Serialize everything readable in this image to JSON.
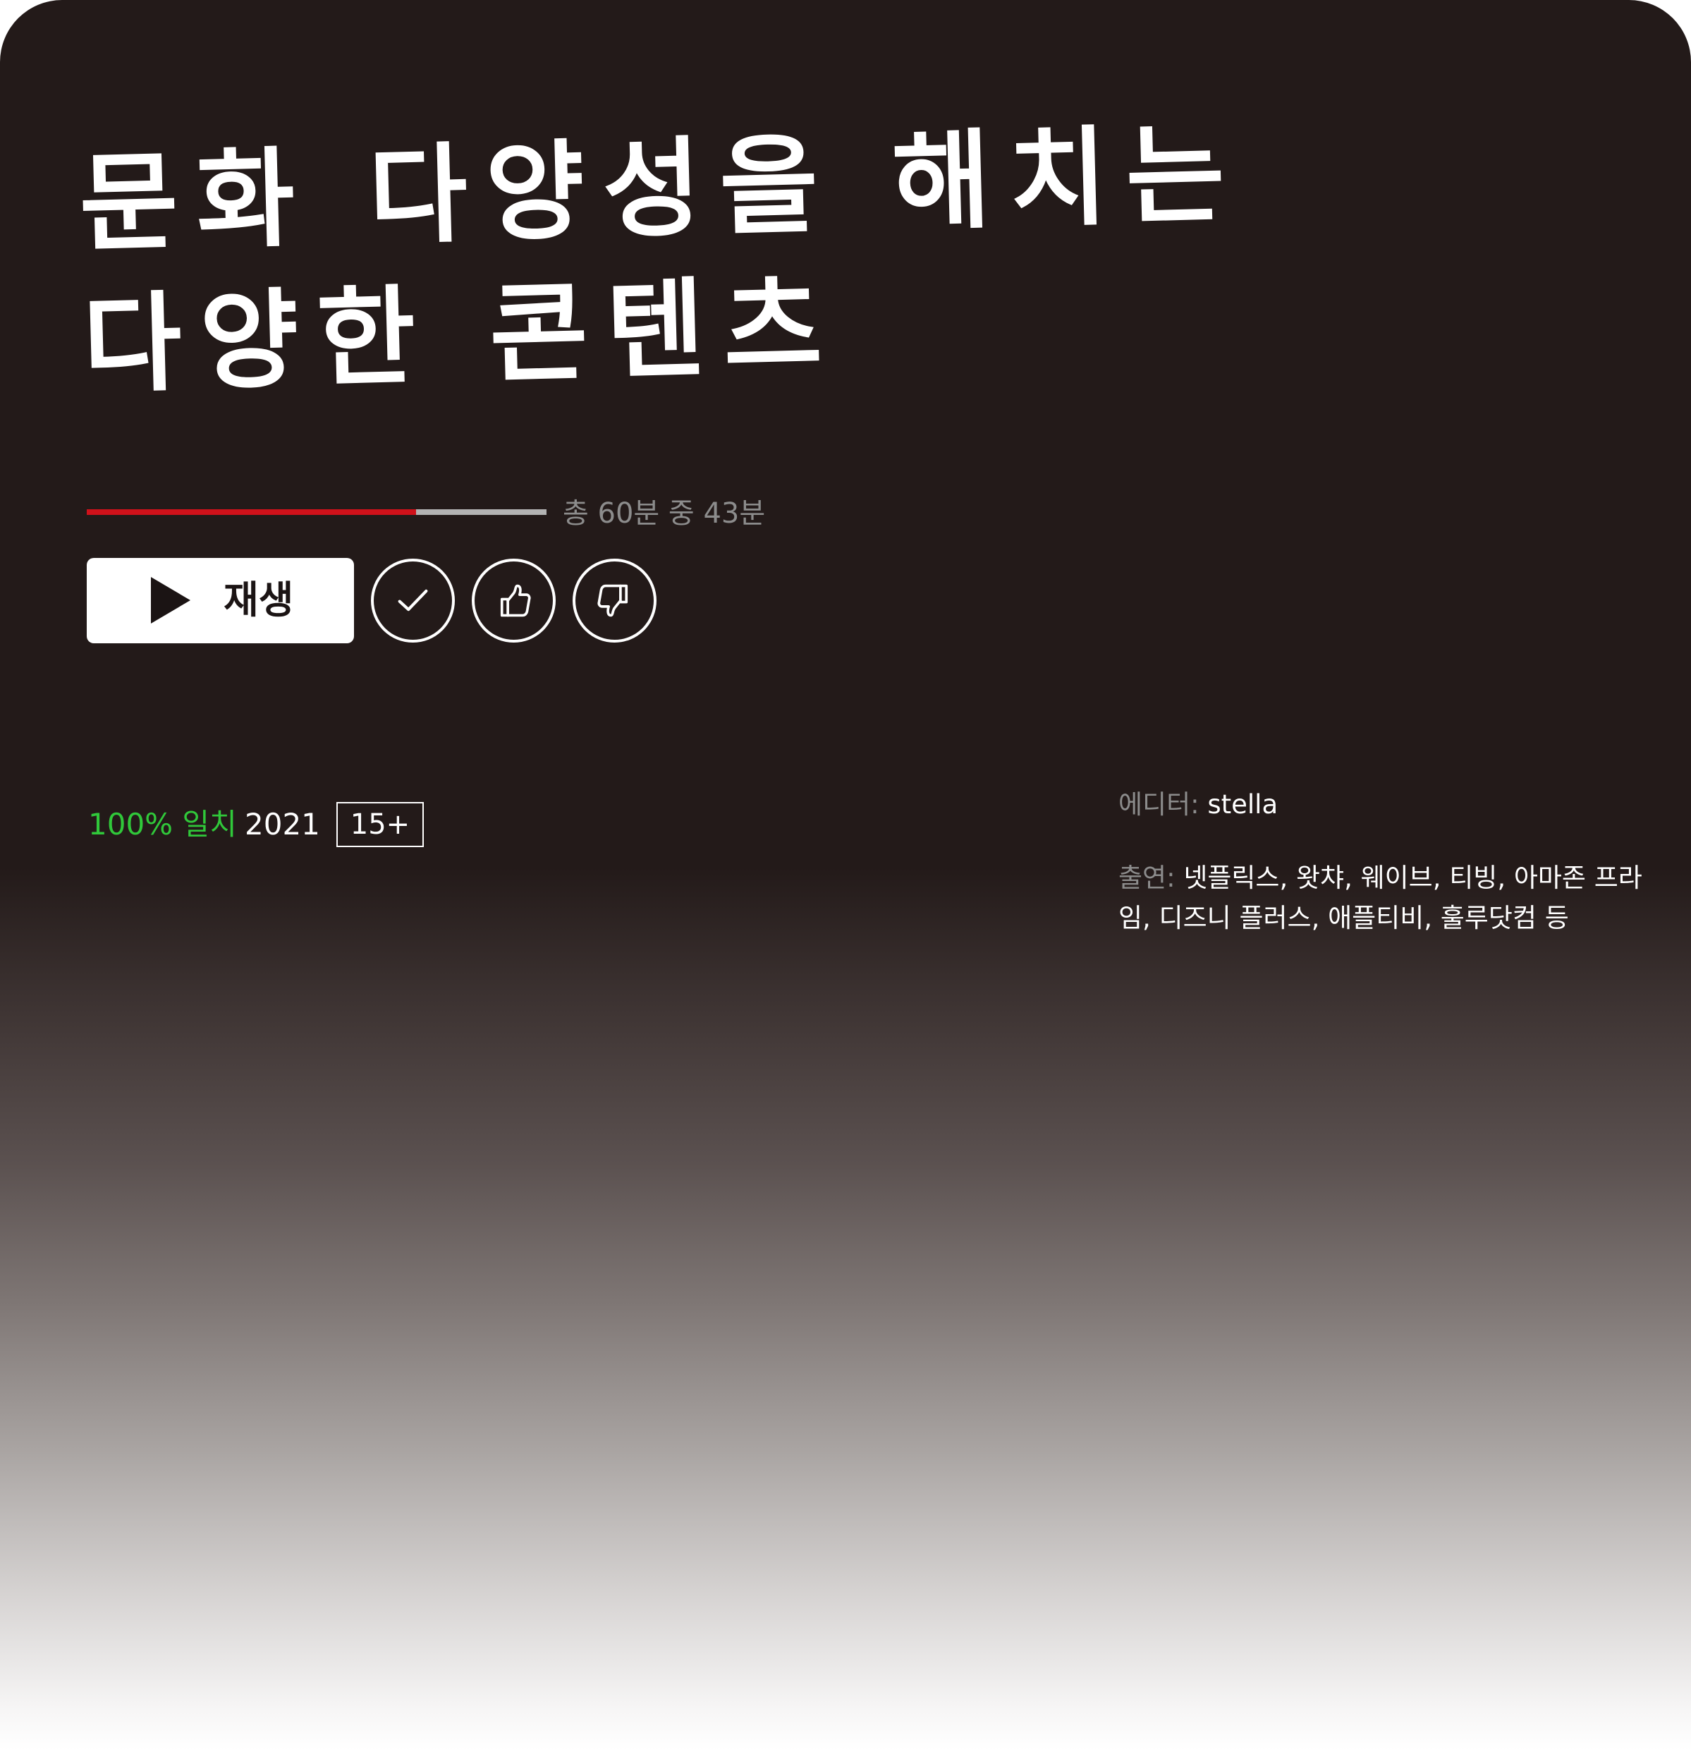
{
  "title": {
    "line1": "문화 다양성을 해치는",
    "line2": "다양한 콘텐츠"
  },
  "progress": {
    "label": "총 60분 중 43분",
    "watched_minutes": 43,
    "total_minutes": 60,
    "fill_color": "#d0111a",
    "track_color": "#b3b3b3"
  },
  "actions": {
    "play_label": "재생",
    "play_icon": "play-icon",
    "add_icon": "check-icon",
    "like_icon": "thumbs-up-icon",
    "dislike_icon": "thumbs-down-icon"
  },
  "meta": {
    "match": "100% 일치",
    "match_color": "#30c83a",
    "year": "2021",
    "rating": "15+"
  },
  "credits": {
    "editor_label": "에디터:",
    "editor": "stella",
    "cast_label": "출연:",
    "cast": "넷플릭스, 왓챠, 웨이브, 티빙, 아마존 프라임, 디즈니 플러스, 애플티비, 훌루닷컴 등"
  },
  "colors": {
    "background_top": "#231a19",
    "background_bottom": "#ffffff",
    "text": "#ffffff",
    "muted_text": "#8c8c8c"
  }
}
